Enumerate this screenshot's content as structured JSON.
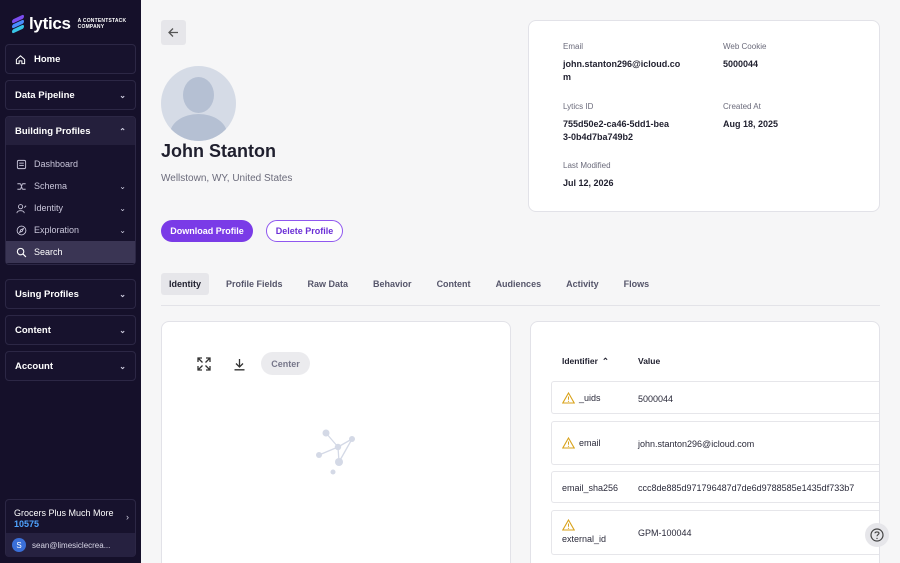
{
  "brand": {
    "name": "lytics",
    "sub_line1": "A CONTENTSTACK",
    "sub_line2": "COMPANY"
  },
  "sidebar": {
    "home": "Home",
    "data_pipeline": "Data Pipeline",
    "building_profiles": "Building Profiles",
    "sub_items": [
      {
        "label": "Dashboard",
        "icon": "dashboard-icon",
        "has_chevron": false
      },
      {
        "label": "Schema",
        "icon": "schema-icon",
        "has_chevron": true
      },
      {
        "label": "Identity",
        "icon": "identity-icon",
        "has_chevron": true
      },
      {
        "label": "Exploration",
        "icon": "compass-icon",
        "has_chevron": true
      },
      {
        "label": "Search",
        "icon": "search-icon",
        "has_chevron": false,
        "active": true
      }
    ],
    "using_profiles": "Using Profiles",
    "content": "Content",
    "account": "Account",
    "account_name": "Grocers Plus Much More",
    "account_id": "10575",
    "user_initial": "S",
    "user_email": "sean@limesiclecrea..."
  },
  "profile": {
    "name": "John Stanton",
    "location": "Wellstown, WY, United States",
    "download_label": "Download Profile",
    "delete_label": "Delete Profile"
  },
  "info": {
    "email_label": "Email",
    "email_value": "john.stanton296@icloud.com",
    "cookie_label": "Web Cookie",
    "cookie_value": "5000044",
    "lytics_id_label": "Lytics ID",
    "lytics_id_value": "755d50e2-ca46-5dd1-bea3-0b4d7ba749b2",
    "created_label": "Created At",
    "created_value": "Aug 18, 2025",
    "modified_label": "Last Modified",
    "modified_value": "Jul 12, 2026"
  },
  "tabs": [
    "Identity",
    "Profile Fields",
    "Raw Data",
    "Behavior",
    "Content",
    "Audiences",
    "Activity",
    "Flows"
  ],
  "graph": {
    "center_label": "Center"
  },
  "identifiers": {
    "col_identifier": "Identifier",
    "col_value": "Value",
    "rows": [
      {
        "key": "_uids",
        "value": "5000044",
        "warning": true
      },
      {
        "key": "email",
        "value": "john.stanton296@icloud.com",
        "warning": true
      },
      {
        "key": "email_sha256",
        "value": "ccc8de885d971796487d7de6d9788585e1435df733b7",
        "warning": false
      },
      {
        "key": "external_id",
        "value": "GPM-100044",
        "warning": true
      }
    ]
  },
  "colors": {
    "accent": "#7a3be7",
    "sidebar_bg": "#15102a",
    "warning": "#d9a21a"
  }
}
